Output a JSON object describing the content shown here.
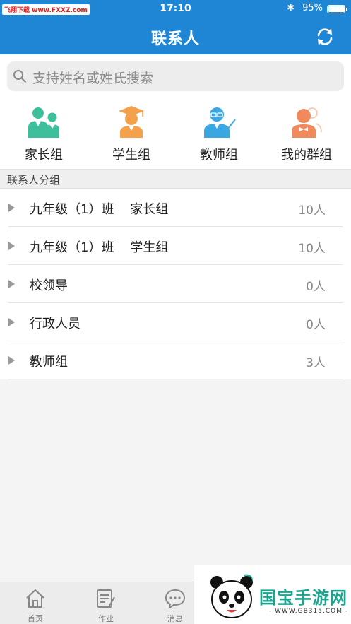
{
  "status_bar": {
    "watermark": "飞翔下载 www.FXXZ.com",
    "time": "17:10",
    "battery": "95%",
    "battery_level": 0.95,
    "bluetooth_icon": "bluetooth-icon"
  },
  "nav": {
    "title": "联系人",
    "refresh_icon": "refresh-icon"
  },
  "search": {
    "placeholder": "支持姓名或姓氏搜索",
    "icon": "search-icon"
  },
  "groups": [
    {
      "label": "家长组",
      "icon": "parents-icon"
    },
    {
      "label": "学生组",
      "icon": "graduate-icon"
    },
    {
      "label": "教师组",
      "icon": "teacher-icon"
    },
    {
      "label": "我的群组",
      "icon": "my-group-icon"
    }
  ],
  "section_header": "联系人分组",
  "contact_groups": [
    {
      "name": "九年级（1）班    家长组",
      "count": "10人"
    },
    {
      "name": "九年级（1）班    学生组",
      "count": "10人"
    },
    {
      "name": "校领导",
      "count": "0人"
    },
    {
      "name": "行政人员",
      "count": "0人"
    },
    {
      "name": "教师组",
      "count": "3人"
    }
  ],
  "tabs": [
    {
      "label": "首页",
      "icon": "home-icon"
    },
    {
      "label": "作业",
      "icon": "homework-icon"
    },
    {
      "label": "消息",
      "icon": "message-icon"
    }
  ],
  "watermark_logo": {
    "brand": "国宝手游网",
    "url": "- WWW.GB315.COM -"
  },
  "colors": {
    "primary": "#1f86d6",
    "parents": "#3cbf9a",
    "student": "#f5a04a",
    "teacher": "#3aa7e3",
    "my_group": "#f08a5d"
  }
}
